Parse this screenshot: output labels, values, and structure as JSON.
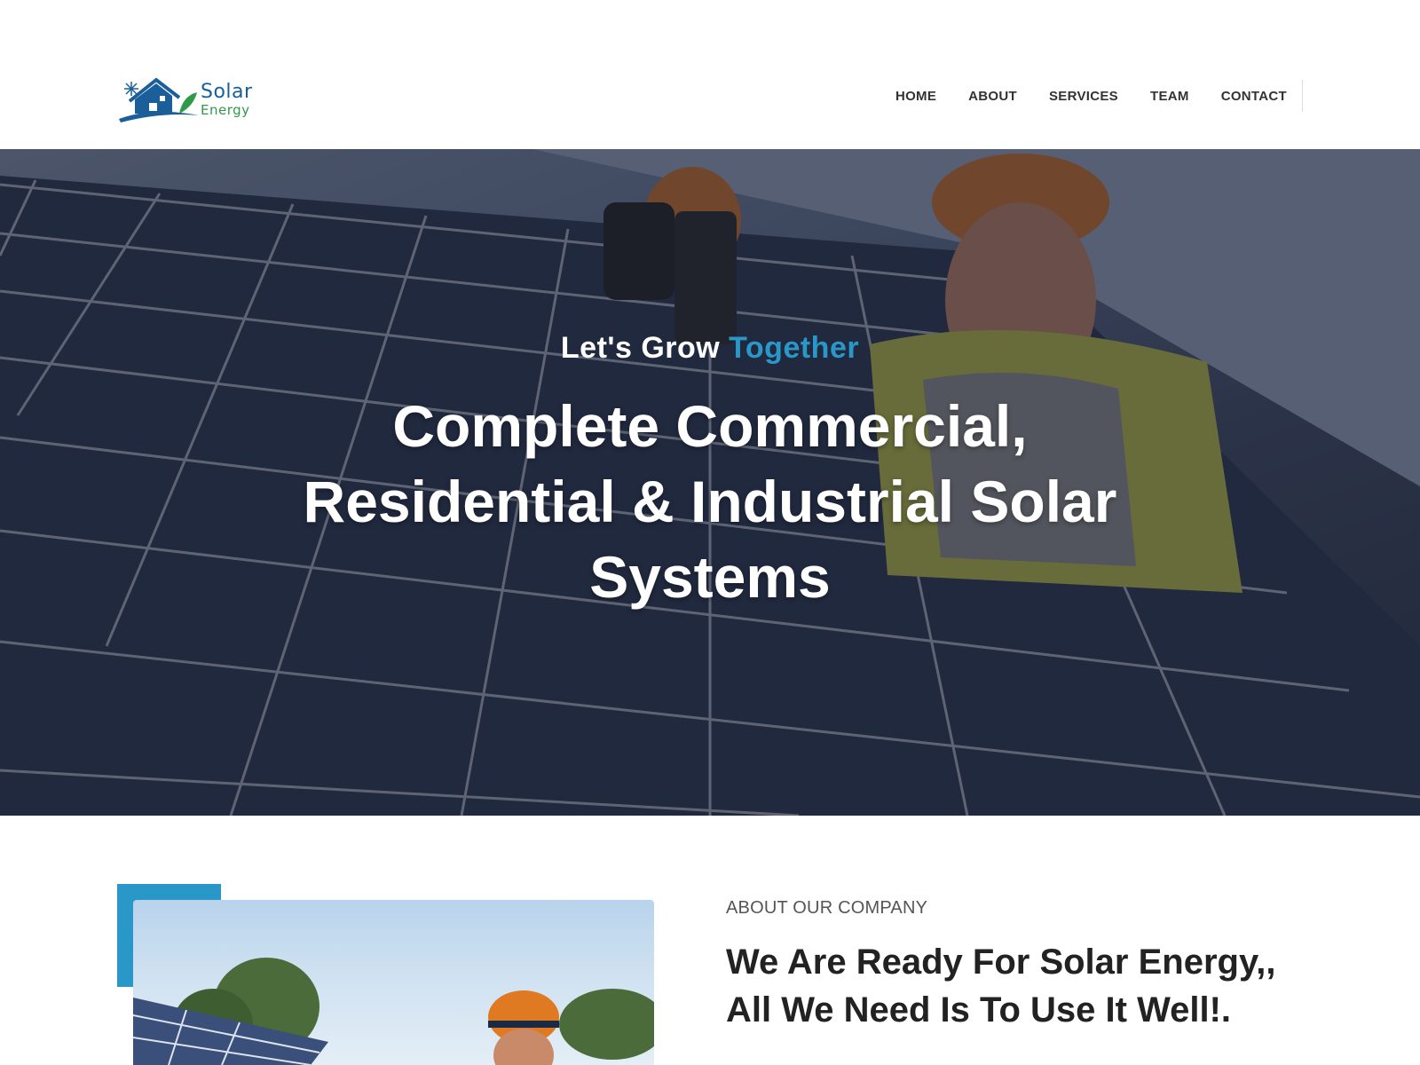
{
  "brand": {
    "name_line1": "Solar",
    "name_line2": "Energy",
    "colors": {
      "primary": "#1a5e9a",
      "green": "#2e9a4a",
      "accent": "#2a97c9"
    }
  },
  "nav": {
    "items": [
      {
        "label": "HOME"
      },
      {
        "label": "ABOUT"
      },
      {
        "label": "SERVICES"
      },
      {
        "label": "TEAM"
      },
      {
        "label": "CONTACT"
      }
    ]
  },
  "hero": {
    "kicker_prefix": "Let's Grow ",
    "kicker_accent": "Together",
    "title": "Complete Commercial, Residential & Industrial Solar Systems"
  },
  "about": {
    "kicker": "ABOUT OUR COMPANY",
    "heading_line1": "We Are Ready For Solar Energy,,",
    "heading_line2_bold": "All We Need Is To Use It Well!",
    "heading_line2_tail": "."
  }
}
